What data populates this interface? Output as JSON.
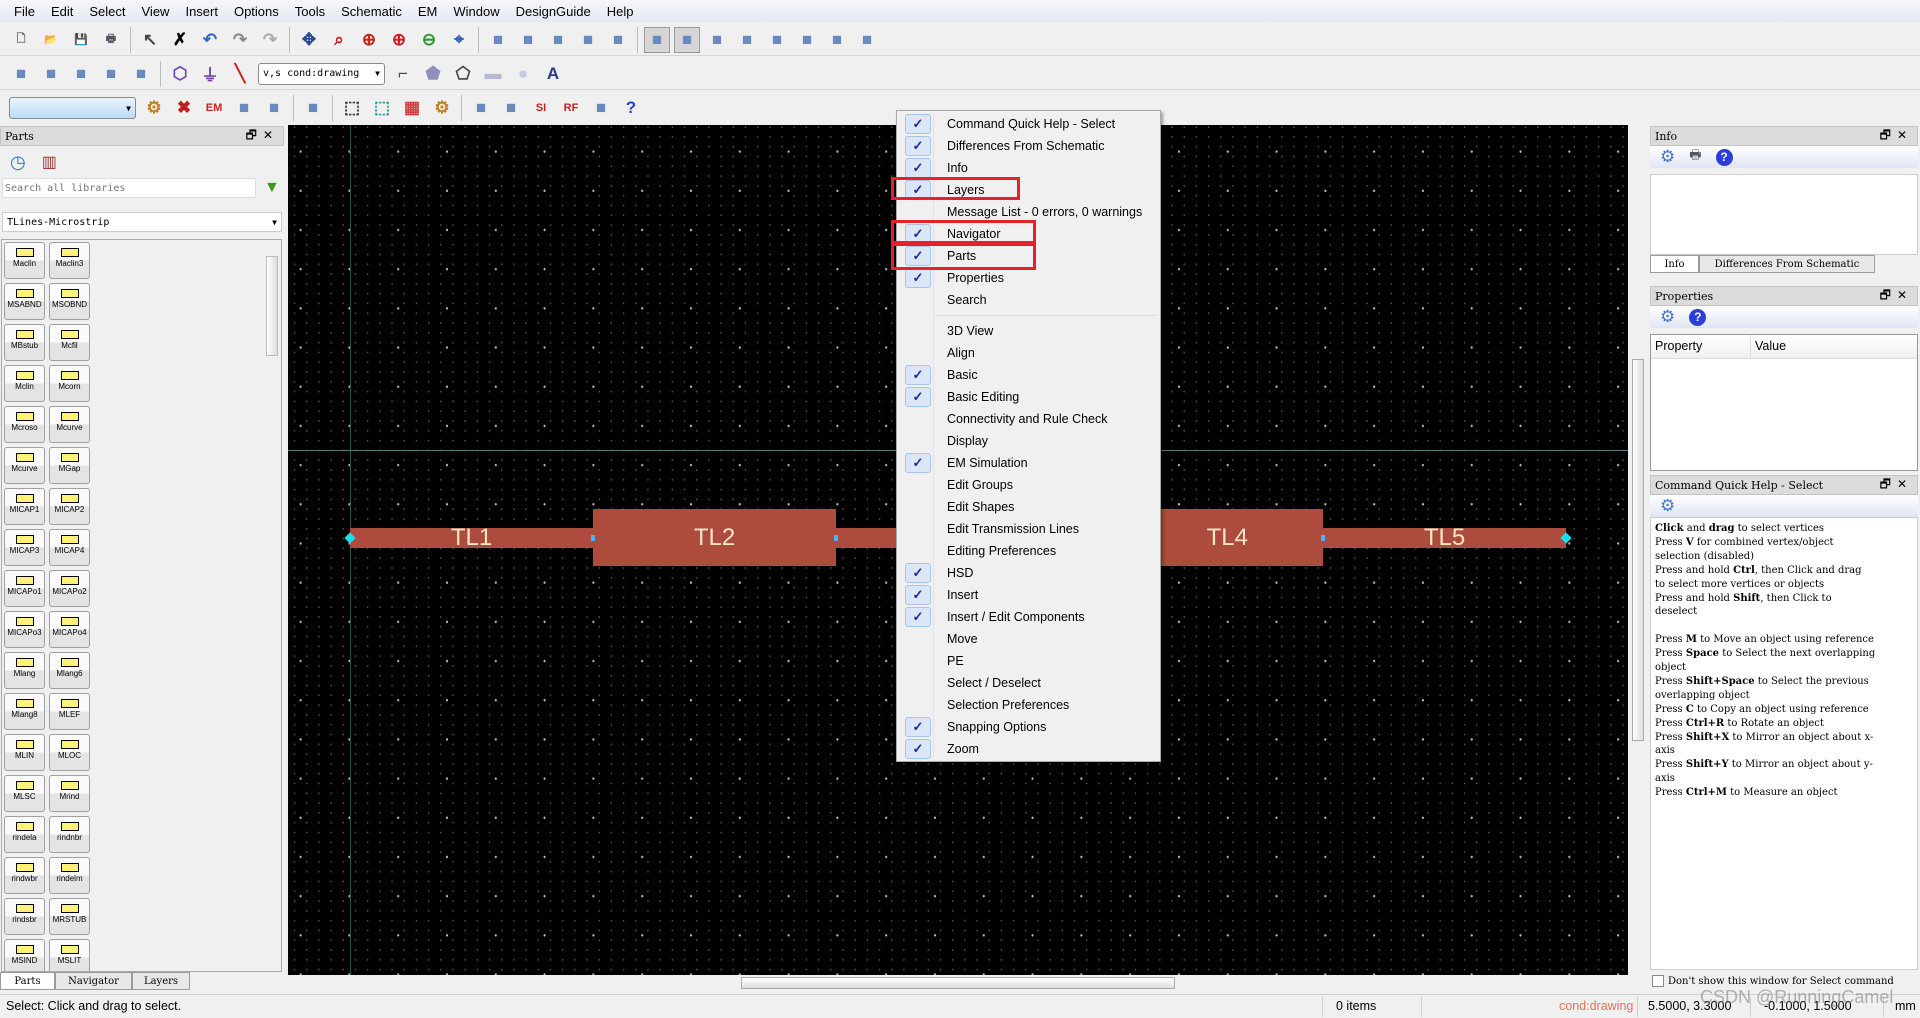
{
  "menubar": [
    "File",
    "Edit",
    "Select",
    "View",
    "Insert",
    "Options",
    "Tools",
    "Schematic",
    "EM",
    "Window",
    "DesignGuide",
    "Help"
  ],
  "toolbar1": [
    "new-file",
    "open-folder",
    "save",
    "print",
    "|",
    "select-arrow",
    "delete-x",
    "undo",
    "redo",
    "redo-disabled",
    "|",
    "pan",
    "zoom-area",
    "zoom-in",
    "zoom-in-2",
    "zoom-out-2",
    "snap-port",
    "|",
    "align-left",
    "align-center",
    "align-flip",
    "align-vertical",
    "align-split",
    "|",
    "select-vertex",
    "select-edge",
    "snap-node",
    "snap-midpoint",
    "snap-end",
    "snap-center",
    "snap-intersection",
    "snap-grid"
  ],
  "toolbar2a": [
    "sim-r17",
    "sim-r17-small",
    "download-green",
    "upload-grey",
    "download-blue",
    "|",
    "port",
    "ground",
    "line-draw"
  ],
  "toolbar2_combo": "v,s cond:drawing",
  "toolbar2b": [
    "trace",
    "polygon",
    "polyline",
    "rectangle",
    "circle",
    "text-A"
  ],
  "toolbar3_combo": "",
  "toolbar3": [
    "em-setup",
    "em-remove",
    "em-box",
    "layer-stack",
    "via",
    "|",
    "port-editor",
    "|",
    "3d-wire",
    "3d-solid",
    "3d-color",
    "3d-gear",
    "|",
    "z50-calc",
    "tline-calc",
    "si-pi",
    "rf",
    "plugin",
    "help-question"
  ],
  "parts": {
    "title": "Parts",
    "search_placeholder": "Search all libraries",
    "library": "TLines-Microstrip",
    "items": [
      "Maclin",
      "Maclin3",
      "MSABND",
      "MSOBND",
      "MBstub",
      "Mcfil",
      "Mclin",
      "Mcorn",
      "Mcroso",
      "Mcurve",
      "Mcurve",
      "MGap",
      "MICAP1",
      "MICAP2",
      "MICAP3",
      "MICAP4",
      "MICAPo1",
      "MICAPo2",
      "MICAPo3",
      "MICAPo4",
      "Mlang",
      "Mlang6",
      "Mlang8",
      "MLEF",
      "MLIN",
      "MLOC",
      "MLSC",
      "Mrind",
      "rindela",
      "rindnbr",
      "rindwbr",
      "rindelm",
      "rindsbr",
      "MRSTUB",
      "MSIND",
      "MSLIT"
    ],
    "tabs": [
      "Parts",
      "Navigator",
      "Layers"
    ]
  },
  "canvas": {
    "lines": [
      "TL1",
      "TL2",
      "TL4",
      "TL5"
    ],
    "line_color": "#ad4c3c"
  },
  "context_menu": {
    "group1": [
      {
        "label": "Command Quick Help - Select",
        "checked": true
      },
      {
        "label": "Differences From Schematic",
        "checked": true
      },
      {
        "label": "Info",
        "checked": true
      },
      {
        "label": "Layers",
        "checked": true
      },
      {
        "label": "Message List - 0 errors, 0 warnings",
        "checked": false
      },
      {
        "label": "Navigator",
        "checked": true
      },
      {
        "label": "Parts",
        "checked": true
      },
      {
        "label": "Properties",
        "checked": true
      },
      {
        "label": "Search",
        "checked": false
      }
    ],
    "group2": [
      {
        "label": "3D View",
        "checked": false
      },
      {
        "label": "Align",
        "checked": false
      },
      {
        "label": "Basic",
        "checked": true
      },
      {
        "label": "Basic Editing",
        "checked": true
      },
      {
        "label": "Connectivity and Rule Check",
        "checked": false
      },
      {
        "label": "Display",
        "checked": false
      },
      {
        "label": "EM Simulation",
        "checked": true
      },
      {
        "label": "Edit Groups",
        "checked": false
      },
      {
        "label": "Edit Shapes",
        "checked": false
      },
      {
        "label": "Edit Transmission Lines",
        "checked": false
      },
      {
        "label": "Editing Preferences",
        "checked": false
      },
      {
        "label": "HSD",
        "checked": true
      },
      {
        "label": "Insert",
        "checked": true
      },
      {
        "label": "Insert / Edit Components",
        "checked": true
      },
      {
        "label": "Move",
        "checked": false
      },
      {
        "label": "PE",
        "checked": false
      },
      {
        "label": "Select / Deselect",
        "checked": false
      },
      {
        "label": "Selection Preferences",
        "checked": false
      },
      {
        "label": "Snapping Options",
        "checked": true
      },
      {
        "label": "Zoom",
        "checked": true
      }
    ],
    "highlight_color": "#e8202a"
  },
  "info": {
    "title": "Info",
    "tabs": [
      "Info",
      "Differences From Schematic"
    ]
  },
  "properties": {
    "title": "Properties",
    "columns": [
      "Property",
      "Value"
    ]
  },
  "quick_help": {
    "title": "Command Quick Help - Select",
    "lines": [
      [
        [
          "Click",
          1
        ],
        [
          " and ",
          0
        ],
        [
          "drag",
          1
        ],
        [
          " to select vertices",
          0
        ]
      ],
      [
        [
          "Press ",
          0
        ],
        [
          "V",
          1
        ],
        [
          " for combined vertex/object",
          0
        ]
      ],
      [
        [
          "selection (disabled)",
          0
        ]
      ],
      [
        [
          "Press and hold ",
          0
        ],
        [
          "Ctrl",
          1
        ],
        [
          ", then Click and drag",
          0
        ]
      ],
      [
        [
          "to select more vertices or objects",
          0
        ]
      ],
      [
        [
          "Press and hold ",
          0
        ],
        [
          "Shift",
          1
        ],
        [
          ", then Click to",
          0
        ]
      ],
      [
        [
          "deselect",
          0
        ]
      ],
      [
        [
          "",
          0
        ]
      ],
      [
        [
          "Press ",
          0
        ],
        [
          "M",
          1
        ],
        [
          " to Move an object using reference",
          0
        ]
      ],
      [
        [
          "Press ",
          0
        ],
        [
          "Space",
          1
        ],
        [
          " to Select the next overlapping",
          0
        ]
      ],
      [
        [
          "object",
          0
        ]
      ],
      [
        [
          "Press ",
          0
        ],
        [
          "Shift+Space",
          1
        ],
        [
          " to Select the previous",
          0
        ]
      ],
      [
        [
          "overlapping object",
          0
        ]
      ],
      [
        [
          "Press ",
          0
        ],
        [
          "C",
          1
        ],
        [
          " to Copy an object using reference",
          0
        ]
      ],
      [
        [
          "Press ",
          0
        ],
        [
          "Ctrl+R",
          1
        ],
        [
          " to Rotate an object",
          0
        ]
      ],
      [
        [
          "Press ",
          0
        ],
        [
          "Shift+X",
          1
        ],
        [
          " to Mirror an object about x-",
          0
        ]
      ],
      [
        [
          "axis",
          0
        ]
      ],
      [
        [
          "Press ",
          0
        ],
        [
          "Shift+Y",
          1
        ],
        [
          " to Mirror an object about y-",
          0
        ]
      ],
      [
        [
          "axis",
          0
        ]
      ],
      [
        [
          "Press ",
          0
        ],
        [
          "Ctrl+M",
          1
        ],
        [
          " to Measure an object",
          0
        ]
      ]
    ],
    "dont_show": "Don't show this window for Select command"
  },
  "status": {
    "message": "Select: Click and drag to select.",
    "items": "0 items",
    "layer": "cond:drawing",
    "layer_color": "#e8705a",
    "coord1": "5.5000, 3.3000",
    "coord2": "-0.1000, 1.5000",
    "unit": "mm"
  },
  "watermark": "CSDN @RunningCamel"
}
